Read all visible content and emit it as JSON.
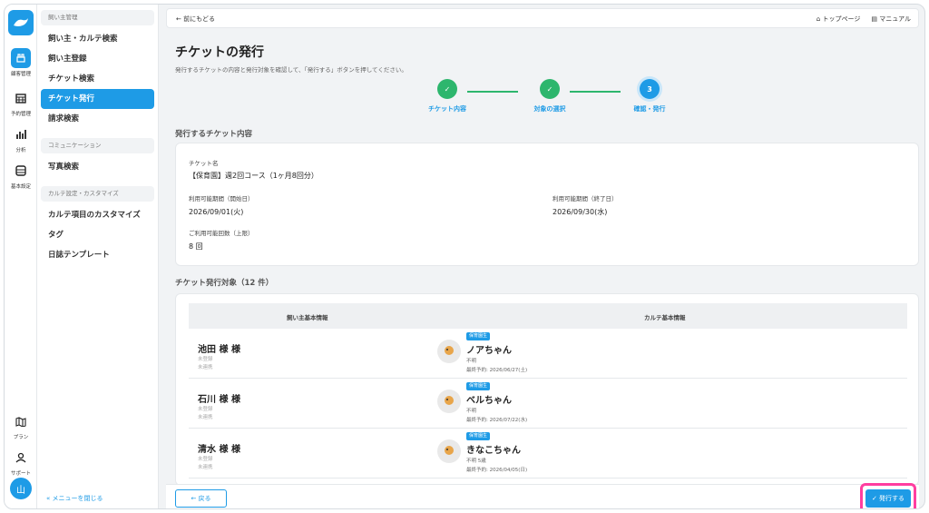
{
  "rail": {
    "items": [
      {
        "label": "顧客管理",
        "icon": "dog-icon"
      },
      {
        "label": "予約管理",
        "icon": "calendar-icon"
      },
      {
        "label": "分析",
        "icon": "chart-icon"
      },
      {
        "label": "基本設定",
        "icon": "settings-icon"
      },
      {
        "label": "プラン",
        "icon": "map-icon"
      },
      {
        "label": "サポート",
        "icon": "support-icon"
      }
    ],
    "avatar": "山"
  },
  "sidebar": {
    "section1": "飼い主管理",
    "items1": [
      "飼い主・カルテ検索",
      "飼い主登録",
      "チケット検索",
      "チケット発行",
      "請求検索"
    ],
    "section2": "コミュニケーション",
    "items2": [
      "写真検索"
    ],
    "section3": "カルテ設定・カスタマイズ",
    "items3": [
      "カルテ項目のカスタマイズ",
      "タグ",
      "日誌テンプレート"
    ],
    "collapse": "« メニューを閉じる"
  },
  "topbar": {
    "back": "← 前にもどる",
    "top_page": "トップページ",
    "manual": "マニュアル"
  },
  "page": {
    "title": "チケットの発行",
    "subtitle": "発行するチケットの内容と発行対象を確認して、「発行する」ボタンを押してください。"
  },
  "steps": [
    {
      "num": "✓",
      "label": "チケット内容"
    },
    {
      "num": "✓",
      "label": "対象の選択"
    },
    {
      "num": "3",
      "label": "確認・発行"
    }
  ],
  "ticket": {
    "heading": "発行するチケット内容",
    "name_label": "チケット名",
    "name": "【保育園】週2回コース（1ヶ月8回分）",
    "start_label": "利用可能期間（開始日）",
    "start": "2026/09/01(火)",
    "end_label": "利用可能期間（終了日）",
    "end": "2026/09/30(水)",
    "count_label": "ご利用可能回数（上限）",
    "count": "8 回"
  },
  "targets": {
    "heading": "チケット発行対象（12 件）",
    "col_owner": "飼い主基本情報",
    "col_karte": "カルテ基本情報",
    "rows": [
      {
        "owner": "池田 様 様",
        "meta1": "未登録",
        "meta2": "未連携",
        "badge": "保育園生",
        "pet": "ノアちゃん",
        "info": "不明",
        "last": "最終予約: 2026/06/27(土)"
      },
      {
        "owner": "石川 様 様",
        "meta1": "未登録",
        "meta2": "未連携",
        "badge": "保育園生",
        "pet": "ベルちゃん",
        "info": "不明",
        "last": "最終予約: 2026/07/22(水)"
      },
      {
        "owner": "清水 様 様",
        "meta1": "未登録",
        "meta2": "未連携",
        "badge": "保育園生",
        "pet": "きなこちゃん",
        "info": "不明  5歳",
        "last": "最終予約: 2026/04/05(日)"
      }
    ]
  },
  "footer": {
    "back_btn": "← 戻る",
    "issue_btn": "✓ 発行する"
  },
  "colors": {
    "accent": "#1e9be6",
    "done": "#2db66d",
    "highlight": "#ff3ea0"
  }
}
